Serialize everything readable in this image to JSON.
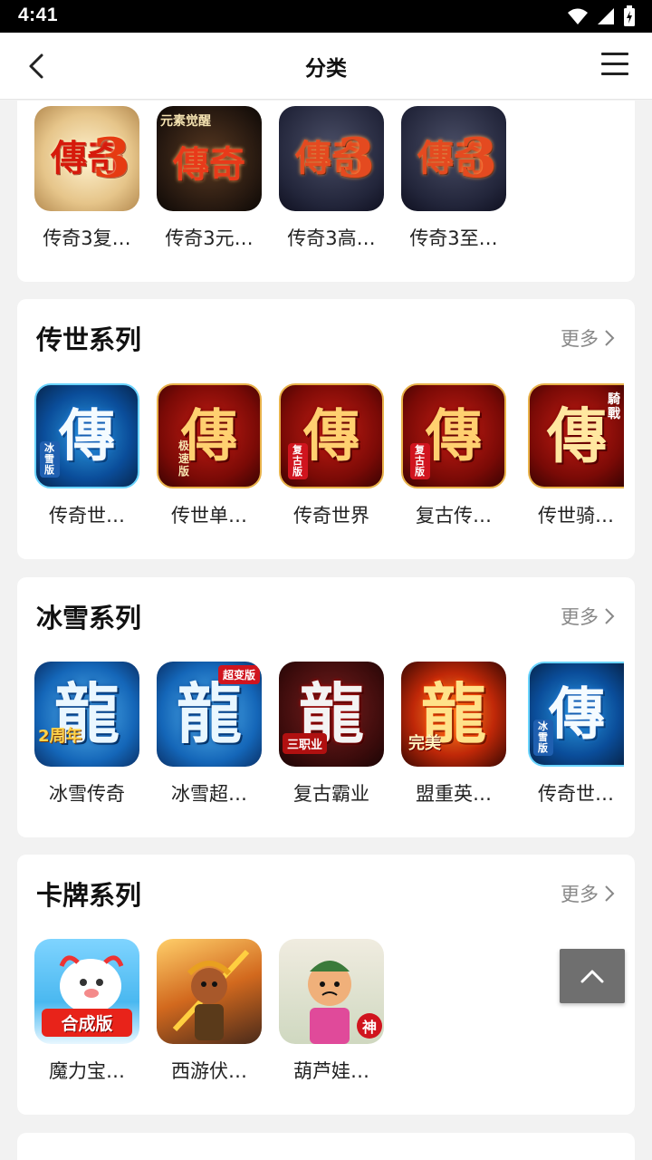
{
  "status": {
    "time": "4:41"
  },
  "header": {
    "title": "分类"
  },
  "sections": [
    {
      "title": "",
      "items": [
        {
          "name": "传奇3复…",
          "glyph": "傳奇",
          "badge": ""
        },
        {
          "name": "传奇3元…",
          "glyph": "傳奇",
          "badge": "元素觉醒"
        },
        {
          "name": "传奇3高…",
          "glyph": "傳奇",
          "badge": ""
        },
        {
          "name": "传奇3至…",
          "glyph": "傳奇",
          "badge": ""
        }
      ]
    },
    {
      "title": "传世系列",
      "more": "更多",
      "items": [
        {
          "name": "传奇世…",
          "glyph": "傳",
          "badge": "冰雪版"
        },
        {
          "name": "传世单…",
          "glyph": "傳",
          "badge": "极速版"
        },
        {
          "name": "传奇世界",
          "glyph": "傳",
          "badge": "复古版"
        },
        {
          "name": "复古传…",
          "glyph": "傳",
          "badge": "复古版"
        },
        {
          "name": "传世骑…",
          "glyph": "傳",
          "badge": "騎戰"
        }
      ]
    },
    {
      "title": "冰雪系列",
      "more": "更多",
      "items": [
        {
          "name": "冰雪传奇",
          "glyph": "龍",
          "badge": "2周年"
        },
        {
          "name": "冰雪超…",
          "glyph": "龍",
          "badge": "超变版"
        },
        {
          "name": "复古霸业",
          "glyph": "龍",
          "badge": "三职业"
        },
        {
          "name": "盟重英…",
          "glyph": "龍",
          "badge": "完美"
        },
        {
          "name": "传奇世…",
          "glyph": "傳",
          "badge": "冰雪版"
        }
      ]
    },
    {
      "title": "卡牌系列",
      "more": "更多",
      "items": [
        {
          "name": "魔力宝…",
          "glyph": "",
          "badge": "合成版"
        },
        {
          "name": "西游伏…",
          "glyph": "",
          "badge": ""
        },
        {
          "name": "葫芦娃…",
          "glyph": "",
          "badge": "神"
        }
      ]
    }
  ],
  "colors": {
    "accent": "#d0141e",
    "background": "#f2f2f2",
    "card": "#ffffff"
  },
  "icons": {
    "back": "chevron-left-icon",
    "menu": "hamburger-menu-icon",
    "more": "chevron-right-icon",
    "to_top": "chevron-up-icon"
  }
}
